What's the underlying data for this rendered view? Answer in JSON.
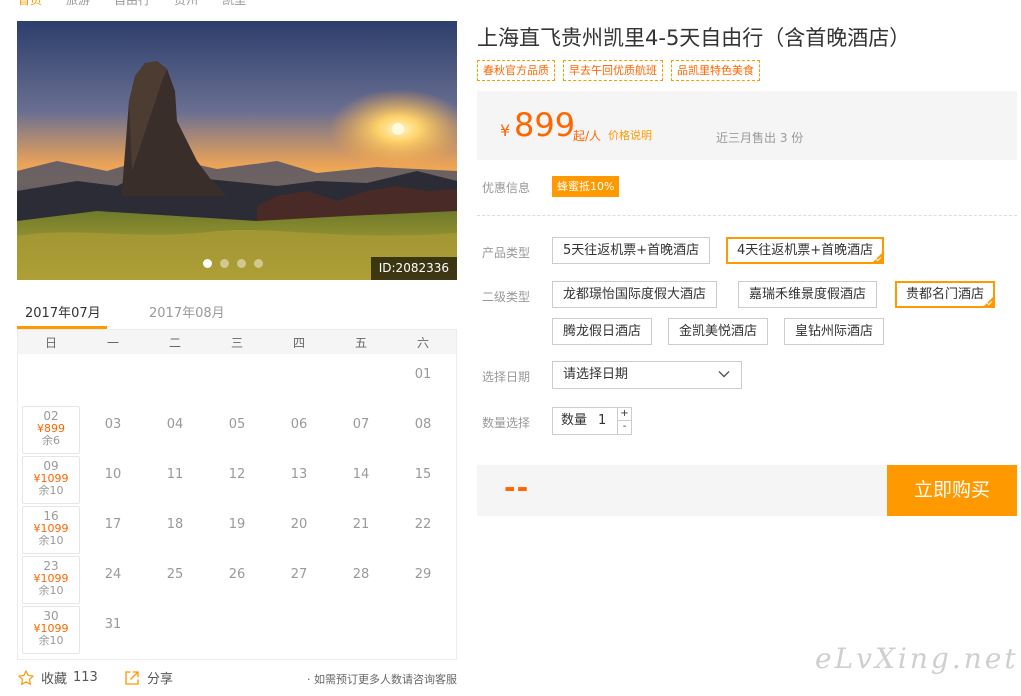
{
  "breadcrumb": [
    "首页",
    "旅游",
    "自由行",
    "贵州",
    "凯里"
  ],
  "hero": {
    "image_id": "ID:2082336",
    "slide_count": 4,
    "active_slide": 1
  },
  "calendar": {
    "tabs": [
      "2017年07月",
      "2017年08月"
    ],
    "weekdays": [
      "日",
      "一",
      "二",
      "三",
      "四",
      "五",
      "六"
    ],
    "first_row_days": [
      {
        "col": 6,
        "day": "01"
      }
    ],
    "weeks": [
      {
        "sun": {
          "day": "02",
          "price": "¥899",
          "stock": "余6"
        },
        "days": [
          "03",
          "04",
          "05",
          "06",
          "07",
          "08"
        ]
      },
      {
        "sun": {
          "day": "09",
          "price": "¥1099",
          "stock": "余10"
        },
        "days": [
          "10",
          "11",
          "12",
          "13",
          "14",
          "15"
        ]
      },
      {
        "sun": {
          "day": "16",
          "price": "¥1099",
          "stock": "余10"
        },
        "days": [
          "17",
          "18",
          "19",
          "20",
          "21",
          "22"
        ]
      },
      {
        "sun": {
          "day": "23",
          "price": "¥1099",
          "stock": "余10"
        },
        "days": [
          "24",
          "25",
          "26",
          "27",
          "28",
          "29"
        ]
      },
      {
        "sun": {
          "day": "30",
          "price": "¥1099",
          "stock": "余10"
        },
        "days": [
          "31"
        ]
      }
    ]
  },
  "actions": {
    "favorite_label": "收藏",
    "favorite_count": "113",
    "share_label": "分享",
    "note": "· 如需预订更多人数请咨询客服"
  },
  "product": {
    "title": "上海直飞贵州凯里4-5天自由行（含首晚酒店）",
    "tags": [
      "春秋官方品质",
      "早去午回优质航班",
      "品凯里特色美食"
    ]
  },
  "price": {
    "currency": "¥",
    "amount": "899",
    "unit": "起/人",
    "explain": "价格说明",
    "sold": "近三月售出 3 份"
  },
  "promo": {
    "label": "优惠信息",
    "badge": "蜂蜜抵10%"
  },
  "product_type": {
    "label": "产品类型",
    "options": [
      "5天往返机票+首晚酒店",
      "4天往返机票+首晚酒店"
    ],
    "selected": 1
  },
  "sub_type": {
    "label": "二级类型",
    "options": [
      "龙都璟怡国际度假大酒店",
      "嘉瑞禾维景度假酒店",
      "贵都名门酒店",
      "腾龙假日酒店",
      "金凯美悦酒店",
      "皇钻州际酒店"
    ],
    "selected": 2
  },
  "date": {
    "label": "选择日期",
    "placeholder": "请选择日期"
  },
  "quantity": {
    "label": "数量选择",
    "prefix": "数量",
    "value": "1",
    "plus": "+",
    "minus": "-"
  },
  "checkout": {
    "total": "--",
    "buy_label": "立即购买"
  },
  "watermark": "eLvXing.net",
  "colors": {
    "accent": "#ff9900",
    "price": "#ff6600",
    "panel": "#f5f5f5"
  }
}
